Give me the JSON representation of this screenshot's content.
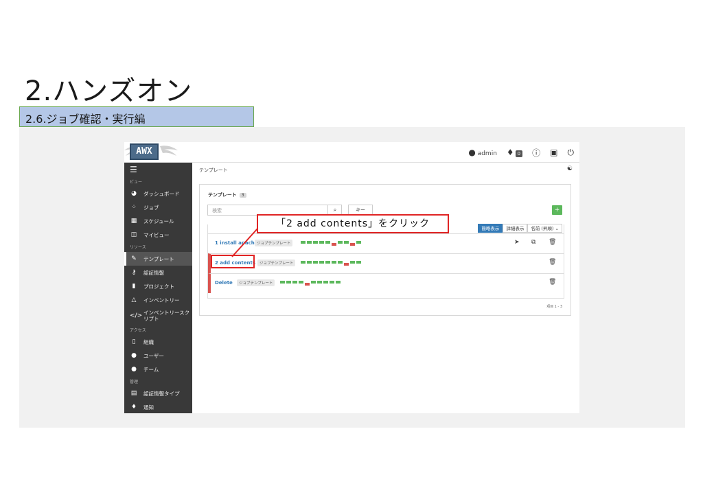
{
  "slide": {
    "title": "2.ハンズオン",
    "subtitle": "2.6.ジョブ確認・実行編"
  },
  "colors": {
    "subtitle_band": "#b4c7e7",
    "sidebar": "#393939",
    "link": "#337ab7",
    "success": "#5cb85c",
    "failed": "#d9534f",
    "callout_border": "#e02424"
  },
  "app": {
    "logo_text": "AWX",
    "topbar": {
      "user_icon": "user-icon",
      "user": "admin",
      "bell_icon": "bell-icon",
      "notification_count": "0",
      "info_icon": "info-icon",
      "docs_icon": "book-icon",
      "logout_icon": "power-icon"
    },
    "sidebar": {
      "menu_icon": "hamburger-icon",
      "sections": {
        "view": "ビュー",
        "resources": "リソース",
        "access": "アクセス",
        "admin": "管理"
      },
      "items": [
        {
          "label": "ダッシュボード",
          "icon": "dashboard-icon"
        },
        {
          "label": "ジョブ",
          "icon": "spinner-icon"
        },
        {
          "label": "スケジュール",
          "icon": "calendar-icon"
        },
        {
          "label": "マイビュー",
          "icon": "columns-icon"
        },
        {
          "label": "テンプレート",
          "icon": "edit-icon"
        },
        {
          "label": "認証情報",
          "icon": "key-icon"
        },
        {
          "label": "プロジェクト",
          "icon": "folder-icon"
        },
        {
          "label": "インベントリー",
          "icon": "sitemap-icon"
        },
        {
          "label": "インベントリースク",
          "label2": "リプト",
          "icon": "code-icon"
        },
        {
          "label": "組織",
          "icon": "building-icon"
        },
        {
          "label": "ユーザー",
          "icon": "user-icon"
        },
        {
          "label": "チーム",
          "icon": "users-icon"
        },
        {
          "label": "認証情報タイプ",
          "icon": "list-icon"
        },
        {
          "label": "通知",
          "icon": "bell-icon"
        }
      ]
    },
    "breadcrumb": "テンプレート",
    "activity_icon": "activity-stream-icon",
    "card": {
      "title": "テンプレート",
      "count": "3",
      "search_placeholder": "検索",
      "search_icon": "search-icon",
      "key_button": "キー",
      "add_button": "+",
      "view_toggles": [
        "簡略表示",
        "詳細表示"
      ],
      "sort": "名前 (昇順)",
      "rows": [
        {
          "name": "1 install apach",
          "type": "ジョブテンプレート",
          "failed": false,
          "recent_jobs": [
            "s",
            "s",
            "s",
            "s",
            "s",
            "f",
            "s",
            "s",
            "f",
            "s"
          ]
        },
        {
          "name": "2 add contents",
          "type": "ジョブテンプレート",
          "failed": true,
          "recent_jobs": [
            "s",
            "s",
            "s",
            "s",
            "s",
            "s",
            "s",
            "f",
            "s",
            "s"
          ]
        },
        {
          "name": "Delete",
          "type": "ジョブテンプレート",
          "failed": true,
          "recent_jobs": [
            "s",
            "s",
            "s",
            "s",
            "f",
            "s",
            "s",
            "s",
            "s",
            "s"
          ]
        }
      ],
      "pager": "項目 1 - 3"
    }
  },
  "callout": {
    "text": "「2 add contents」をクリック"
  }
}
